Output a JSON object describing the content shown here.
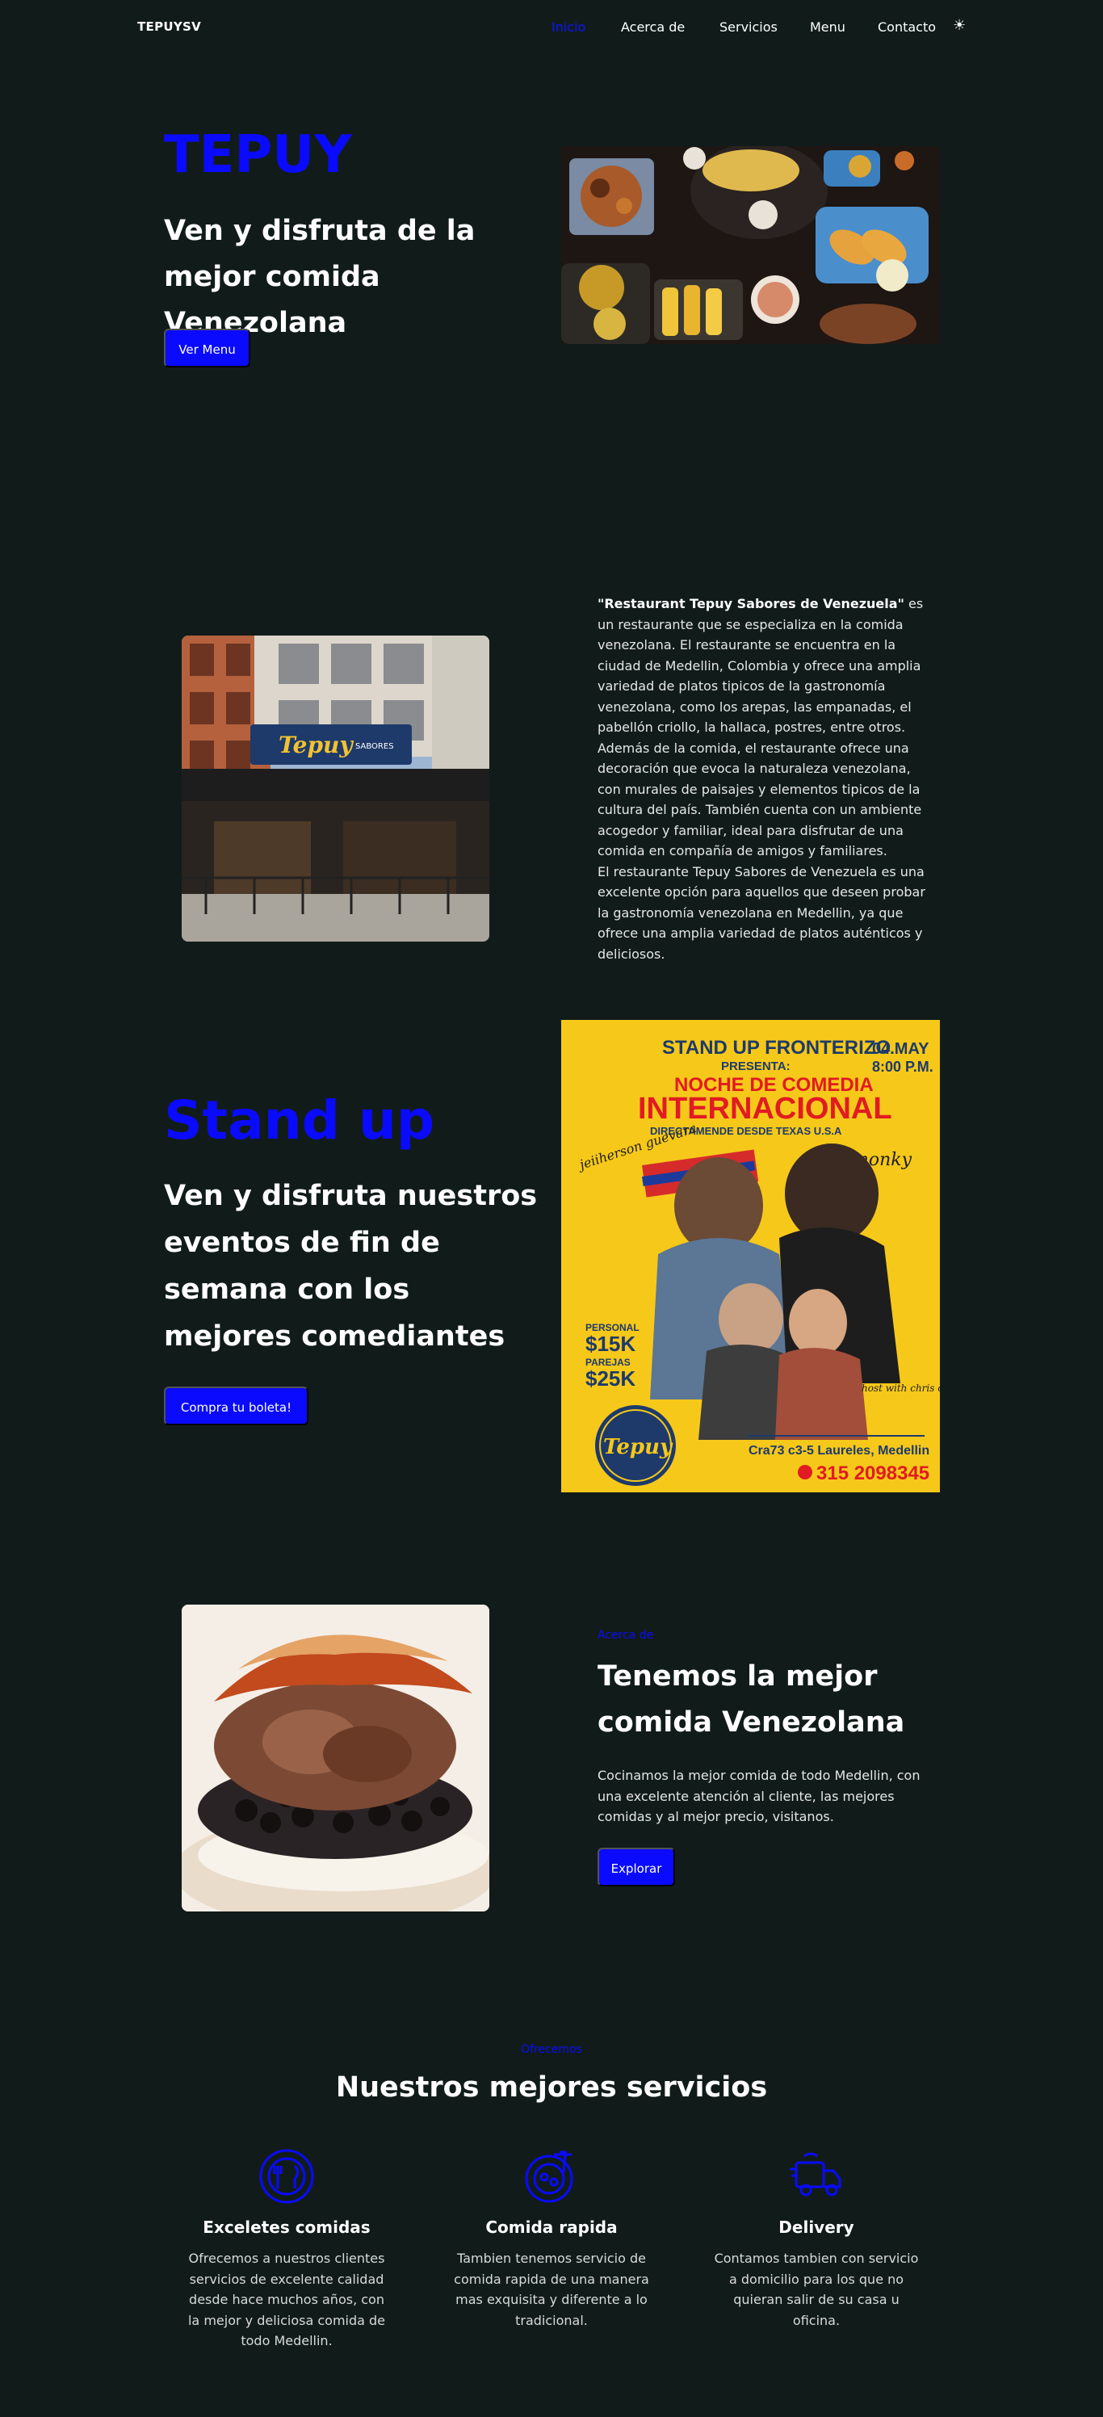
{
  "nav": {
    "brand": "TEPUYSV",
    "items": [
      "Inicio",
      "Acerca de",
      "Servicios",
      "Menu",
      "Contacto"
    ],
    "theme_icon": "sun-icon"
  },
  "hero": {
    "title": "TEPUY",
    "subtitle": "Ven y disfruta de la mejor comida Venezolana",
    "button": "Ver Menu"
  },
  "about": {
    "name": "\"Restaurant Tepuy Sabores de Venezuela\"",
    "paragraph1": " es un restaurante que se especializa en la comida venezolana. El restaurante se encuentra en la ciudad de Medellin, Colombia y ofrece una amplia variedad de platos tipicos de la gastronomía venezolana, como los arepas, las empanadas, el pabellón criollo, la hallaca, postres, entre otros. Además de la comida, el restaurante ofrece una decoración que evoca la naturaleza venezolana, con murales de paisajes y elementos tipicos de la cultura del país. También cuenta con un ambiente acogedor y familiar, ideal para disfrutar de una comida en compañía de amigos y familiares.",
    "paragraph2": "El restaurante Tepuy Sabores de Venezuela es una excelente opción para aquellos que deseen probar la gastronomía venezolana en Medellin, ya que ofrece una amplia variedad de platos auténticos y deliciosos."
  },
  "standup": {
    "title": "Stand up",
    "subtitle": "Ven y disfruta nuestros eventos de fin de semana con los mejores comediantes",
    "button": "Compra tu boleta!",
    "poster": {
      "header": "STAND UP FRONTERIZO",
      "presenta": "PRESENTA:",
      "line1": "NOCHE DE COMEDIA",
      "line2": "INTERNACIONAL",
      "line3": "DIRECTAMENDE DESDE TEXAS U.S.A",
      "date1": "04.MAY",
      "date2": "8:00 P.M.",
      "name_left": "jeiiherson guevara",
      "name_right": "monky",
      "price1_label": "PERSONAL",
      "price1": "$15K",
      "price2_label": "PAREJAS",
      "price2": "$25K",
      "host": "host with chris camero",
      "address": "Cra73 c3-5 Laureles, Medellin",
      "phone": "315 2098345",
      "logo": "Tepuy"
    }
  },
  "food": {
    "kicker": "Acerca de",
    "title": "Tenemos la mejor comida Venezolana",
    "description": "Cocinamos la mejor comida de todo Medellin, con una excelente atención al cliente, las mejores comidas y al mejor precio, visitanos.",
    "button": "Explorar"
  },
  "services": {
    "kicker": "Ofrecemos",
    "title": "Nuestros mejores servicios",
    "items": [
      {
        "icon": "dining-icon",
        "name": "Exceletes comidas",
        "description": "Ofrecemos a nuestros clientes servicios de excelente calidad desde hace muchos años, con la mejor y deliciosa comida de todo Medellin."
      },
      {
        "icon": "fast-food-icon",
        "name": "Comida rapida",
        "description": "Tambien tenemos servicio de comida rapida de una manera mas exquisita y diferente a lo tradicional."
      },
      {
        "icon": "delivery-truck-icon",
        "name": "Delivery",
        "description": "Contamos tambien con servicio a domicilio para los que no quieran salir de su casa u oficina."
      }
    ]
  },
  "colors": {
    "background": "#111c1a",
    "accent": "#0a0aff"
  }
}
